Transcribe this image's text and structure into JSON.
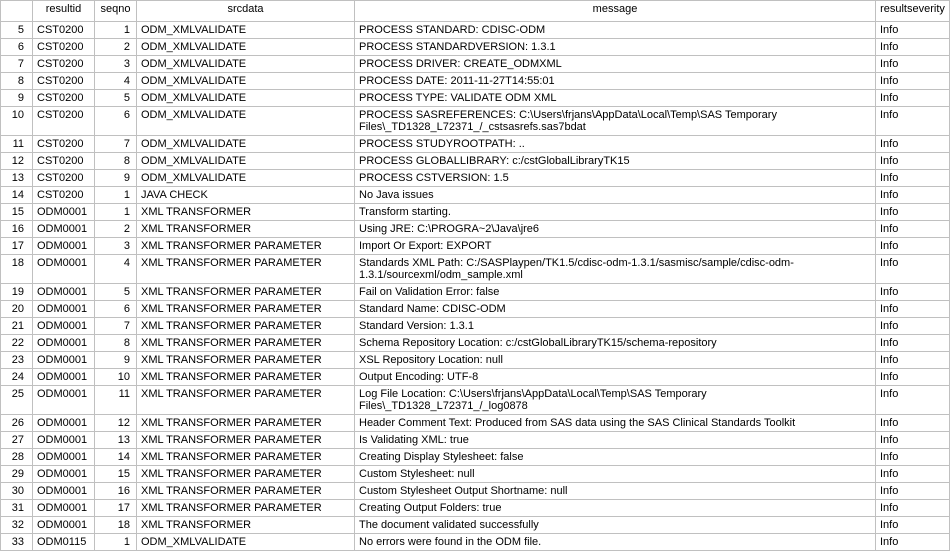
{
  "columns": {
    "resultid": "resultid",
    "seqno": "seqno",
    "srcdata": "srcdata",
    "message": "message",
    "resultseverity": "resultseverity"
  },
  "rows": [
    {
      "n": "5",
      "resultid": "CST0200",
      "seqno": "1",
      "srcdata": "ODM_XMLVALIDATE",
      "message": "PROCESS STANDARD: CDISC-ODM",
      "severity": "Info"
    },
    {
      "n": "6",
      "resultid": "CST0200",
      "seqno": "2",
      "srcdata": "ODM_XMLVALIDATE",
      "message": "PROCESS STANDARDVERSION: 1.3.1",
      "severity": "Info"
    },
    {
      "n": "7",
      "resultid": "CST0200",
      "seqno": "3",
      "srcdata": "ODM_XMLVALIDATE",
      "message": "PROCESS DRIVER: CREATE_ODMXML",
      "severity": "Info"
    },
    {
      "n": "8",
      "resultid": "CST0200",
      "seqno": "4",
      "srcdata": "ODM_XMLVALIDATE",
      "message": "PROCESS DATE: 2011-11-27T14:55:01",
      "severity": "Info"
    },
    {
      "n": "9",
      "resultid": "CST0200",
      "seqno": "5",
      "srcdata": "ODM_XMLVALIDATE",
      "message": "PROCESS TYPE: VALIDATE ODM XML",
      "severity": "Info"
    },
    {
      "n": "10",
      "resultid": "CST0200",
      "seqno": "6",
      "srcdata": "ODM_XMLVALIDATE",
      "message": "PROCESS SASREFERENCES: C:\\Users\\frjans\\AppData\\Local\\Temp\\SAS Temporary Files\\_TD1328_L72371_/_cstsasrefs.sas7bdat",
      "severity": "Info"
    },
    {
      "n": "11",
      "resultid": "CST0200",
      "seqno": "7",
      "srcdata": "ODM_XMLVALIDATE",
      "message": "PROCESS STUDYROOTPATH: ..",
      "severity": "Info"
    },
    {
      "n": "12",
      "resultid": "CST0200",
      "seqno": "8",
      "srcdata": "ODM_XMLVALIDATE",
      "message": "PROCESS GLOBALLIBRARY: c:/cstGlobalLibraryTK15",
      "severity": "Info"
    },
    {
      "n": "13",
      "resultid": "CST0200",
      "seqno": "9",
      "srcdata": "ODM_XMLVALIDATE",
      "message": "PROCESS CSTVERSION: 1.5",
      "severity": "Info"
    },
    {
      "n": "14",
      "resultid": "CST0200",
      "seqno": "1",
      "srcdata": "JAVA CHECK",
      "message": "No Java issues",
      "severity": "Info"
    },
    {
      "n": "15",
      "resultid": "ODM0001",
      "seqno": "1",
      "srcdata": "XML TRANSFORMER",
      "message": "Transform starting.",
      "severity": "Info"
    },
    {
      "n": "16",
      "resultid": "ODM0001",
      "seqno": "2",
      "srcdata": "XML TRANSFORMER",
      "message": "Using JRE: C:\\PROGRA~2\\Java\\jre6",
      "severity": "Info"
    },
    {
      "n": "17",
      "resultid": "ODM0001",
      "seqno": "3",
      "srcdata": "XML TRANSFORMER PARAMETER",
      "message": "Import Or Export: EXPORT",
      "severity": "Info"
    },
    {
      "n": "18",
      "resultid": "ODM0001",
      "seqno": "4",
      "srcdata": "XML TRANSFORMER PARAMETER",
      "message": "Standards XML Path: C:/SASPlaypen/TK1.5/cdisc-odm-1.3.1/sasmisc/sample/cdisc-odm-1.3.1/sourcexml/odm_sample.xml",
      "severity": "Info"
    },
    {
      "n": "19",
      "resultid": "ODM0001",
      "seqno": "5",
      "srcdata": "XML TRANSFORMER PARAMETER",
      "message": "Fail on Validation Error: false",
      "severity": "Info"
    },
    {
      "n": "20",
      "resultid": "ODM0001",
      "seqno": "6",
      "srcdata": "XML TRANSFORMER PARAMETER",
      "message": "Standard Name: CDISC-ODM",
      "severity": "Info"
    },
    {
      "n": "21",
      "resultid": "ODM0001",
      "seqno": "7",
      "srcdata": "XML TRANSFORMER PARAMETER",
      "message": "Standard Version: 1.3.1",
      "severity": "Info"
    },
    {
      "n": "22",
      "resultid": "ODM0001",
      "seqno": "8",
      "srcdata": "XML TRANSFORMER PARAMETER",
      "message": "Schema Repository Location: c:/cstGlobalLibraryTK15/schema-repository",
      "severity": "Info"
    },
    {
      "n": "23",
      "resultid": "ODM0001",
      "seqno": "9",
      "srcdata": "XML TRANSFORMER PARAMETER",
      "message": "XSL Repository Location: null",
      "severity": "Info"
    },
    {
      "n": "24",
      "resultid": "ODM0001",
      "seqno": "10",
      "srcdata": "XML TRANSFORMER PARAMETER",
      "message": "Output Encoding: UTF-8",
      "severity": "Info"
    },
    {
      "n": "25",
      "resultid": "ODM0001",
      "seqno": "11",
      "srcdata": "XML TRANSFORMER PARAMETER",
      "message": "Log File Location: C:\\Users\\frjans\\AppData\\Local\\Temp\\SAS Temporary Files\\_TD1328_L72371_/_log0878",
      "severity": "Info"
    },
    {
      "n": "26",
      "resultid": "ODM0001",
      "seqno": "12",
      "srcdata": "XML TRANSFORMER PARAMETER",
      "message": "Header Comment Text: Produced from SAS data using the SAS Clinical Standards Toolkit",
      "severity": "Info"
    },
    {
      "n": "27",
      "resultid": "ODM0001",
      "seqno": "13",
      "srcdata": "XML TRANSFORMER PARAMETER",
      "message": "Is Validating XML: true",
      "severity": "Info"
    },
    {
      "n": "28",
      "resultid": "ODM0001",
      "seqno": "14",
      "srcdata": "XML TRANSFORMER PARAMETER",
      "message": "Creating Display Stylesheet: false",
      "severity": "Info"
    },
    {
      "n": "29",
      "resultid": "ODM0001",
      "seqno": "15",
      "srcdata": "XML TRANSFORMER PARAMETER",
      "message": "Custom Stylesheet: null",
      "severity": "Info"
    },
    {
      "n": "30",
      "resultid": "ODM0001",
      "seqno": "16",
      "srcdata": "XML TRANSFORMER PARAMETER",
      "message": "Custom Stylesheet Output Shortname: null",
      "severity": "Info"
    },
    {
      "n": "31",
      "resultid": "ODM0001",
      "seqno": "17",
      "srcdata": "XML TRANSFORMER PARAMETER",
      "message": "Creating Output Folders: true",
      "severity": "Info"
    },
    {
      "n": "32",
      "resultid": "ODM0001",
      "seqno": "18",
      "srcdata": "XML TRANSFORMER",
      "message": "The document validated successfully",
      "severity": "Info"
    },
    {
      "n": "33",
      "resultid": "ODM0115",
      "seqno": "1",
      "srcdata": "ODM_XMLVALIDATE",
      "message": "No errors were found in the ODM file.",
      "severity": "Info"
    }
  ]
}
